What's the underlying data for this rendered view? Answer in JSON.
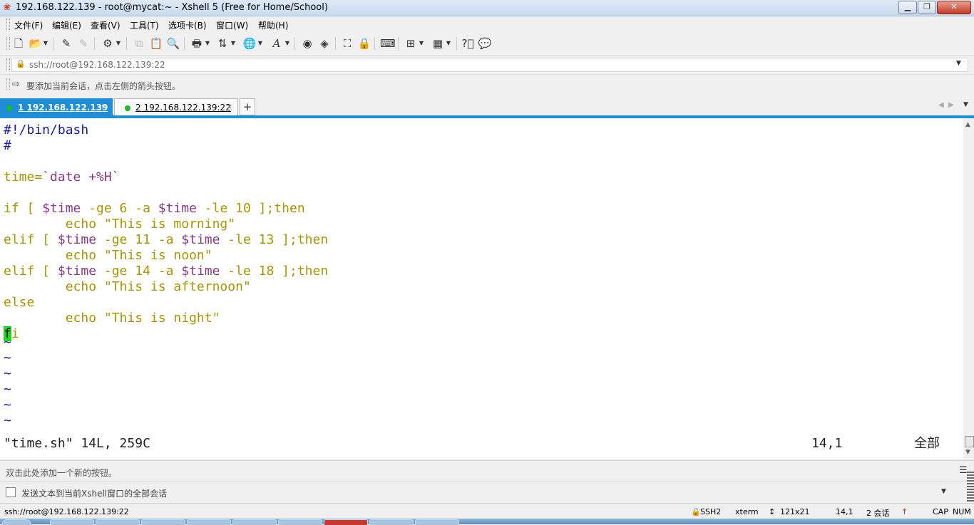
{
  "window": {
    "title": "192.168.122.139 - root@mycat:~ - Xshell 5 (Free for Home/School)",
    "icon": "xshell-app-icon",
    "buttons": {
      "minimize": "▁",
      "maximize": "❐",
      "close": "✕"
    }
  },
  "menu": {
    "items": [
      {
        "label": "文件(F)"
      },
      {
        "label": "编辑(E)"
      },
      {
        "label": "查看(V)"
      },
      {
        "label": "工具(T)"
      },
      {
        "label": "选项卡(B)"
      },
      {
        "label": "窗口(W)"
      },
      {
        "label": "帮助(H)"
      }
    ]
  },
  "toolbar": {
    "icons": [
      "new-session-icon",
      "open-folder-icon",
      "reconnect-icon",
      "disconnect-icon",
      "properties-icon",
      "copy-icon",
      "paste-icon",
      "find-icon",
      "print-icon",
      "transfer-icon",
      "globe-icon",
      "font-icon",
      "xftp-icon",
      "xmanager-icon",
      "fullscreen-icon",
      "lock-icon",
      "keyboard-icon",
      "new-tab-icon",
      "layout-icon",
      "help-icon",
      "chat-icon"
    ]
  },
  "address": {
    "value": "ssh://root@192.168.122.139:22"
  },
  "hint": {
    "text": "要添加当前会话，点击左侧的箭头按钮。"
  },
  "tabs": [
    {
      "label": "1 192.168.122.139",
      "close": "×",
      "active": true
    },
    {
      "label": "2 192.168.122.139:22",
      "close": "×",
      "active": false
    }
  ],
  "tab_add": "+",
  "terminal": {
    "line01": "#!/bin/bash",
    "line02": "#",
    "line04a": "time=",
    "line04b": "`date +%H`",
    "line06a": "if [ ",
    "line06b": "$time",
    "line06c": " -ge 6 -a ",
    "line06d": "$time",
    "line06e": " -le 10 ];then",
    "line07": "        echo \"This is morning\"",
    "line08a": "elif [ ",
    "line08b": "$time",
    "line08c": " -ge 11 -a ",
    "line08d": "$time",
    "line08e": " -le 13 ];then",
    "line09": "        echo \"This is noon\"",
    "line10a": "elif [ ",
    "line10b": "$time",
    "line10c": " -ge 14 -a ",
    "line10d": "$time",
    "line10e": " -le 18 ];then",
    "line11": "        echo \"This is afternoon\"",
    "line12": "else",
    "line13": "        echo \"This is night\"",
    "line14a": "f",
    "line14b": "i",
    "tilde": "~",
    "status_file": "\"time.sh\" 14L, 259C",
    "status_pos": "14,1",
    "status_all": "全部"
  },
  "quickbar": {
    "text": "双击此处添加一个新的按钮。"
  },
  "compose": {
    "text": "发送文本到当前Xshell窗口的全部会话"
  },
  "statusbar": {
    "connection": "ssh://root@192.168.122.139:22",
    "protocol": "SSH2",
    "term": "xterm",
    "size": "121x21",
    "cursor": "14,1",
    "sessions": "2 会话",
    "caps": "CAP",
    "num": "NUM"
  },
  "colors": {
    "accent": "#1f8ed9",
    "comment_blue": "#1a19a8",
    "keyword_olive": "#a99600",
    "variable_purple": "#8b3a8b",
    "cursor_green": "#21d621",
    "session_dot": "#1dbb2c"
  }
}
